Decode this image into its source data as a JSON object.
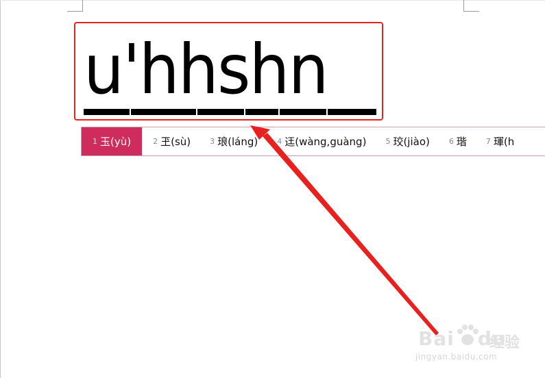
{
  "document": {
    "composition_text": "u'hhshn"
  },
  "ime": {
    "candidates": [
      {
        "index": "1",
        "text": "玉(yù)",
        "selected": true
      },
      {
        "index": "2",
        "text": "玊(sù)",
        "selected": false
      },
      {
        "index": "3",
        "text": "琅(láng)",
        "selected": false
      },
      {
        "index": "4",
        "text": "迋(wàng,guàng)",
        "selected": false
      },
      {
        "index": "5",
        "text": "珓(jiào)",
        "selected": false
      },
      {
        "index": "6",
        "text": "瑎",
        "selected": false
      },
      {
        "index": "7",
        "text": "琿(h",
        "selected": false
      }
    ],
    "selected_color": "#cf2c5e"
  },
  "annotation": {
    "highlight_color": "#e8211f",
    "arrow_color": "#e8211f"
  },
  "watermark": {
    "brand": "Bai",
    "brand_suffix": "du",
    "product": "经验",
    "url": "jingyan.baidu.com"
  }
}
